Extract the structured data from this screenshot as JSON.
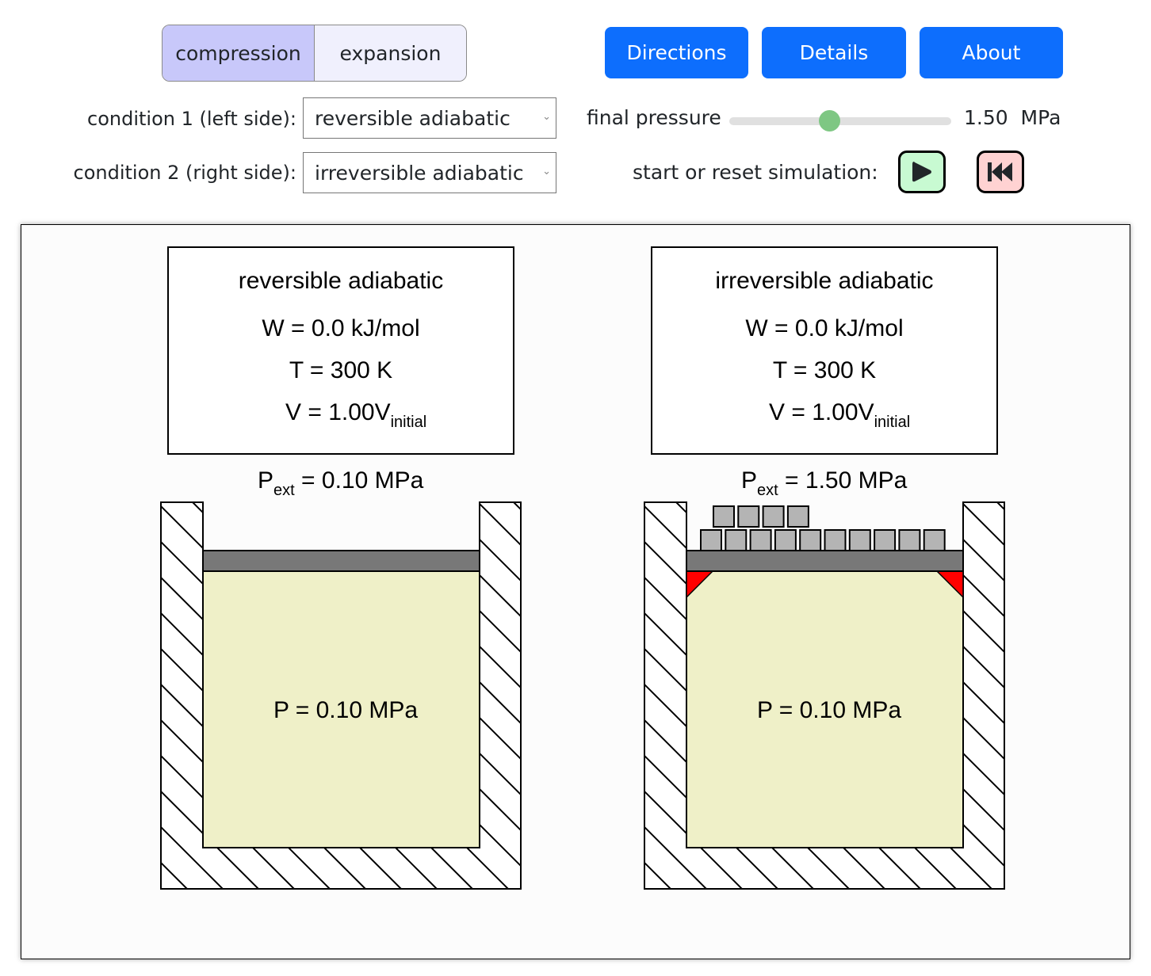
{
  "mode_toggle": {
    "options": [
      "compression",
      "expansion"
    ],
    "selected": "compression"
  },
  "nav_buttons": {
    "directions": "Directions",
    "details": "Details",
    "about": "About"
  },
  "conditions": {
    "condition1": {
      "label": "condition 1 (left side):",
      "value": "reversible adiabatic"
    },
    "condition2": {
      "label": "condition 2 (right side):",
      "value": "irreversible adiabatic"
    }
  },
  "final_pressure": {
    "label": "final pressure",
    "value": 1.5,
    "display": "1.50  MPa",
    "slider_fraction": 0.45
  },
  "simulation": {
    "label": "start or reset simulation:",
    "start_icon": "play-icon",
    "reset_icon": "skip-back-icon"
  },
  "colors": {
    "accent": "#0d6efd",
    "toggle_active": "#c8c8fa",
    "toggle_inactive": "#f0f0fd",
    "slider_thumb": "#7ec783",
    "start_bg": "#c8fad2",
    "reset_bg": "#ffd2d2",
    "gas": "#eff0c8",
    "piston": "#787878",
    "weight": "#b4b4b4",
    "stop": "#ff0000"
  },
  "left_panel": {
    "title": "reversible adiabatic",
    "work": "W = 0.0 kJ/mol",
    "temperature": "T = 300 K",
    "volume_main": "V = 1.00V",
    "volume_sub": "initial",
    "pext_main": "P",
    "pext_sub": "ext",
    "pext_value": " = 0.10 MPa",
    "gas_pressure": "P = 0.10 MPa",
    "weights": 0,
    "stops": false
  },
  "right_panel": {
    "title": "irreversible adiabatic",
    "work": "W = 0.0 kJ/mol",
    "temperature": "T = 300 K",
    "volume_main": "V = 1.00V",
    "volume_sub": "initial",
    "pext_main": "P",
    "pext_sub": "ext",
    "pext_value": " = 1.50 MPa",
    "gas_pressure": "P = 0.10 MPa",
    "weights_bottom_row": 10,
    "weights_top_row": 4,
    "stops": true
  }
}
